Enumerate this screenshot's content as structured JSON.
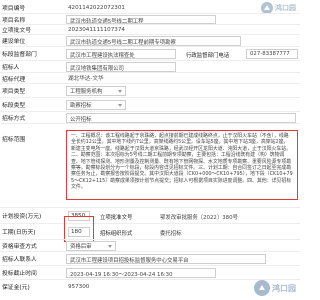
{
  "rows": {
    "code": {
      "label": "项目编号",
      "value": "4201142022072301"
    },
    "project_name": {
      "label": "项目名称",
      "value": "武汉市轨道交通5号线二期工程"
    },
    "approval_no": {
      "label": "立项批文号",
      "value": "2023041111107374"
    },
    "construction_unit": {
      "label": "建设单位",
      "value": "武汉市轨道交通5号线二期工程前期专项勘察"
    },
    "supervisor_dept": {
      "label": "标段监督部门",
      "value": "武汉市工程建设执法稽查处",
      "extra_label": "行政监督部门电话",
      "extra_value": "027-83387777"
    },
    "tender_unit": {
      "label": "招标人",
      "value": "武汉地铁集团有限公司"
    },
    "agency": {
      "label": "招标代理",
      "value": "湖北华达-文华"
    },
    "project_type": {
      "label": "项目类型",
      "value": "工程服务机构"
    },
    "bid_section_type": {
      "label": "标段类型",
      "value": "勘察招标"
    },
    "method": {
      "label": "招标方式",
      "value": "公开招标"
    },
    "scope": {
      "label": "招标范围",
      "value": "一、工程概况：该工程线路起于京珠路，起点接前期已建成线路终点，止于汉阳火车站（不含），线路全长约12公里，其中地下线约7公里，高架线路约5公里。设车站5座，其中地下站3座，高架站2座，新建主变电所一座。线路起于汉阳大道京珠路，经武汉经开区龙阳大道、沌阳大道，止于汉阳火车站。二、勘察范围：本次招标为5号线二期工程前期专项勘察，主要包括：工程沿线既有建（构）筑物调查、地下管线探测、地形测量及控制测量、既有地下管网物探、水文地质专项勘察、重要风险源专项勘察等。勘察标段划分为一个标段，标段内容详见招标文件。三、计划工期：自合同签订之日起至完成勘察任务为止，勘察报告按阶段提交。其中汉阳大道段（CK0+000～CK10+795），地下段（CK10+795～CK12+115）勘察成果须按计划节点提交；招标人可根据项目实际进度调整。四、其他：详见招标文件。"
    },
    "planned_investment": {
      "label": "计划投资(万元)",
      "value": "3850",
      "reg_label": "立项批准文号",
      "reg_value": "鄂发改审批服务〔2022〕380号"
    },
    "duration": {
      "label": "工期(日历天)",
      "value": "180",
      "reg_label": "招标组织形式",
      "reg_value": "委托招标"
    },
    "qualification": {
      "label": "资格审查方式",
      "value": "资格后审"
    },
    "bid_unit_name": {
      "label": "招标人联系人",
      "value": "武汉市工程建设项目招投标监督服务中心交易平台"
    },
    "bid_time": {
      "label": "投标截止时间",
      "value": "2023-04-19 16:30～2023-04-24 16:30"
    },
    "deposit": {
      "label": "保证金(元)",
      "value": "957300"
    }
  },
  "watermark": {
    "text": "鸿口园"
  }
}
